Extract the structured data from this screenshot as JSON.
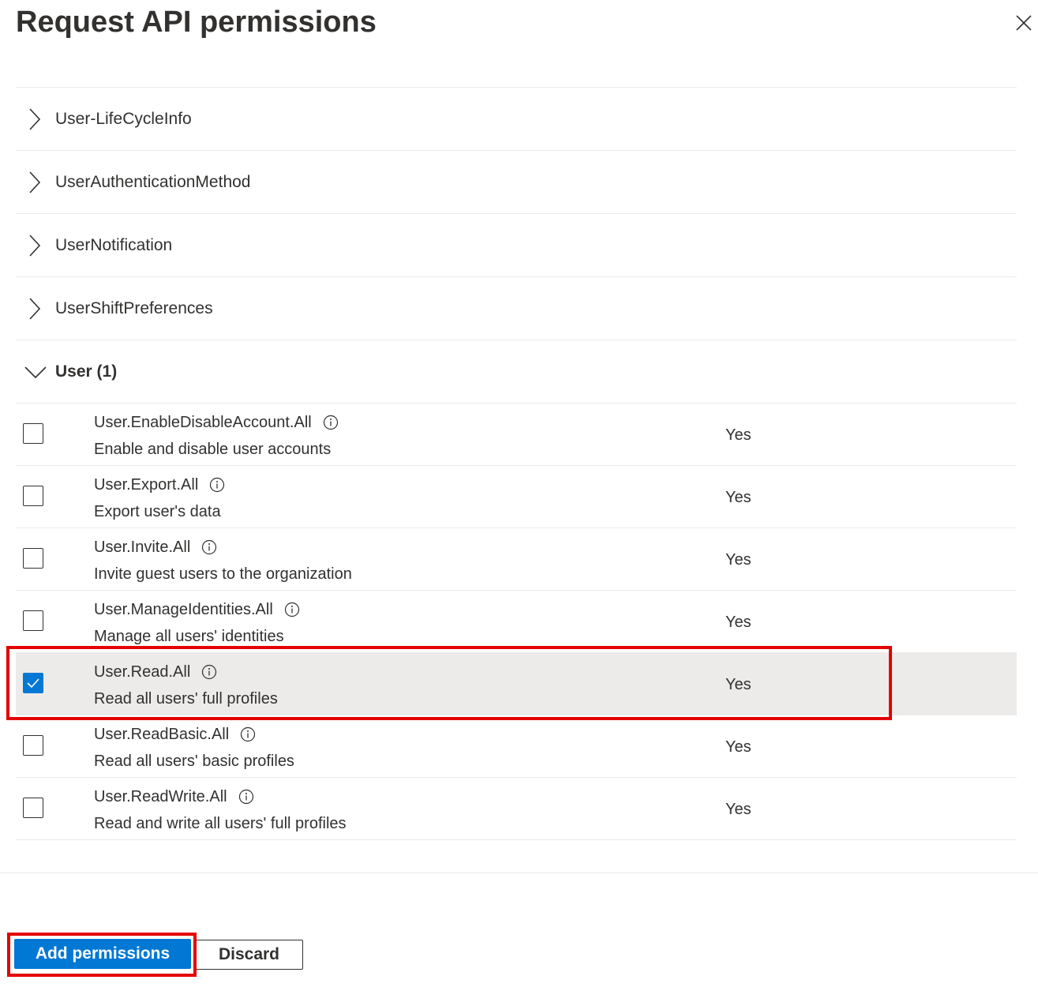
{
  "panel": {
    "title": "Request API permissions",
    "close_icon": "close-icon"
  },
  "groups": [
    {
      "label": "User-LifeCycleInfo",
      "expanded": false
    },
    {
      "label": "UserAuthenticationMethod",
      "expanded": false
    },
    {
      "label": "UserNotification",
      "expanded": false
    },
    {
      "label": "UserShiftPreferences",
      "expanded": false
    },
    {
      "label": "User (1)",
      "expanded": true
    }
  ],
  "permissions": [
    {
      "name": "User.EnableDisableAccount.All",
      "description": "Enable and disable user accounts",
      "admin_consent": "Yes",
      "checked": false
    },
    {
      "name": "User.Export.All",
      "description": "Export user's data",
      "admin_consent": "Yes",
      "checked": false
    },
    {
      "name": "User.Invite.All",
      "description": "Invite guest users to the organization",
      "admin_consent": "Yes",
      "checked": false
    },
    {
      "name": "User.ManageIdentities.All",
      "description": "Manage all users' identities",
      "admin_consent": "Yes",
      "checked": false
    },
    {
      "name": "User.Read.All",
      "description": "Read all users' full profiles",
      "admin_consent": "Yes",
      "checked": true
    },
    {
      "name": "User.ReadBasic.All",
      "description": "Read all users' basic profiles",
      "admin_consent": "Yes",
      "checked": false
    },
    {
      "name": "User.ReadWrite.All",
      "description": "Read and write all users' full profiles",
      "admin_consent": "Yes",
      "checked": false
    }
  ],
  "footer": {
    "add_label": "Add permissions",
    "discard_label": "Discard"
  },
  "colors": {
    "accent": "#0078d4",
    "highlight": "#e50000",
    "selected_row": "#edebe9"
  }
}
